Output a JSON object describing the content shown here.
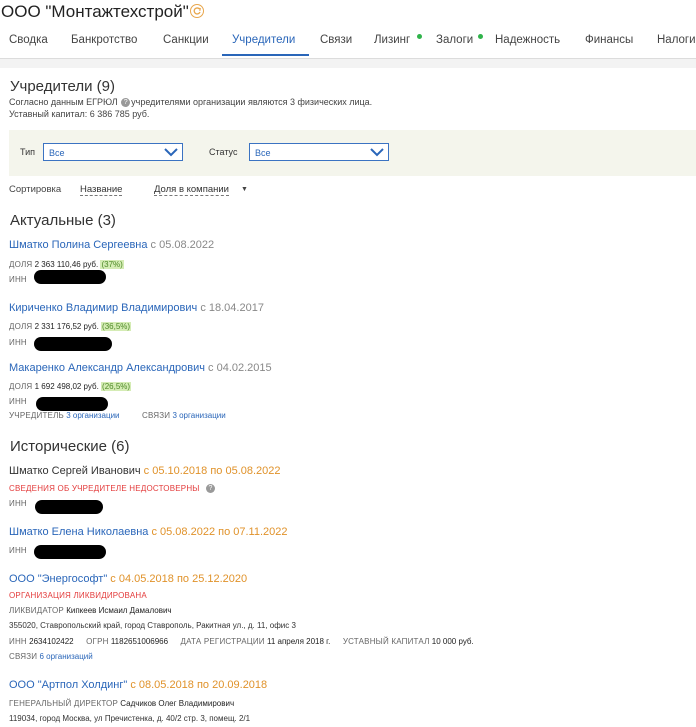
{
  "header": {
    "company": "ООО \"Монтажтехстрой\"",
    "tabs": [
      {
        "label": "Сводка"
      },
      {
        "label": "Банкротство"
      },
      {
        "label": "Санкции"
      },
      {
        "label": "Учредители",
        "active": true
      },
      {
        "label": "Связи"
      },
      {
        "label": "Лизинг",
        "dot": true
      },
      {
        "label": "Залоги",
        "dot": true
      },
      {
        "label": "Надежность"
      },
      {
        "label": "Финансы"
      },
      {
        "label": "Налоги"
      }
    ]
  },
  "founders": {
    "title": "Учредители (9)",
    "egrul_pre": "Согласно данным ЕГРЮЛ",
    "egrul_post": "учредителями организации являются 3 физических лица.",
    "capital": "Уставный капитал: 6 386 785 руб."
  },
  "filters": {
    "type_label": "Тип",
    "type_value": "Все",
    "status_label": "Статус",
    "status_value": "Все"
  },
  "sort": {
    "label": "Сортировка",
    "by_name": "Название",
    "by_share": "Доля в компании"
  },
  "actual": {
    "title": "Актуальные (3)",
    "items": [
      {
        "name": "Шматко Полина Сергеевна",
        "since": "с 05.08.2022",
        "share_label": "ДОЛЯ",
        "share": "2 363 110,46 руб.",
        "pct": "(37%)",
        "inn_label": "ИНН"
      },
      {
        "name": "Кириченко Владимир Владимирович",
        "since": "с 18.04.2017",
        "share_label": "ДОЛЯ",
        "share": "2 331 176,52 руб.",
        "pct": "(36,5%)",
        "inn_label": "ИНН"
      },
      {
        "name": "Макаренко Александр Александрович",
        "since": "с 04.02.2015",
        "share_label": "ДОЛЯ",
        "share": "1 692 498,02 руб.",
        "pct": "(26,5%)",
        "inn_label": "ИНН",
        "founder_label": "УЧРЕДИТЕЛЬ",
        "founder_value": "3 организации",
        "links_label": "СВЯЗИ",
        "links_value": "3 организации"
      }
    ]
  },
  "historical": {
    "title": "Исторические (6)",
    "items": [
      {
        "name": "Шматко Сергей Иванович",
        "period": "с 05.10.2018 по 05.08.2022",
        "alert": "СВЕДЕНИЯ ОБ УЧРЕДИТЕЛЕ НЕДОСТОВЕРНЫ",
        "inn_label": "ИНН"
      },
      {
        "name": "Шматко Елена Николаевна",
        "period": "с 05.08.2022 по 07.11.2022",
        "inn_label": "ИНН"
      },
      {
        "name": "ООО \"Энергософт\"",
        "period": "с 04.05.2018 по 25.12.2020",
        "alert": "ОРГАНИЗАЦИЯ ЛИКВИДИРОВАНА",
        "role_label": "ЛИКВИДАТОР",
        "role_value": "Кипкеев Исмаил Дамалович",
        "address": "355020, Ставропольский край, город Ставрополь, Ракитная ул., д. 11, офис 3",
        "inn_label": "ИНН",
        "inn": "2634102422",
        "ogrn_label": "ОГРН",
        "ogrn": "1182651006966",
        "reg_label": "ДАТА РЕГИСТРАЦИИ",
        "reg": "11 апреля 2018 г.",
        "cap_label": "УСТАВНЫЙ КАПИТАЛ",
        "cap": "10 000 руб.",
        "links_label": "СВЯЗИ",
        "links_value": "6 организаций"
      },
      {
        "name": "ООО \"Артпол Холдинг\"",
        "period": "с 08.05.2018 по 20.09.2018",
        "role_label": "ГЕНЕРАЛЬНЫЙ ДИРЕКТОР",
        "role_value": "Садчиков Олег Владимирович",
        "address": "119034, город Москва, ул Пречистенка, д. 40/2 стр. 3, помещ. 2/1"
      }
    ]
  }
}
